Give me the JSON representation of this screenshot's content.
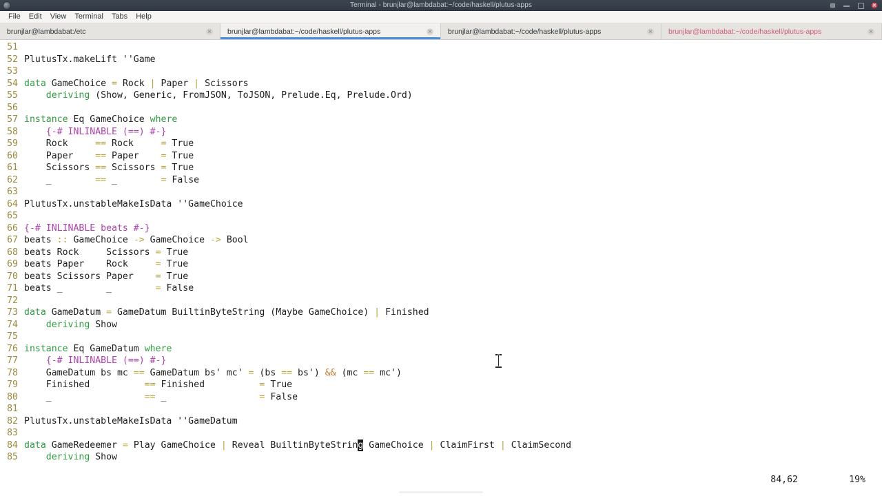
{
  "window": {
    "title": "Terminal - brunjlar@lambdabat:~/code/haskell/plutus-apps",
    "app_icon": "terminal-icon",
    "controls": {
      "shade_label": "Shade",
      "minimize_label": "Minimize",
      "maximize_label": "Maximize",
      "close_label": "Close"
    }
  },
  "menubar": {
    "items": [
      {
        "label": "File"
      },
      {
        "label": "Edit"
      },
      {
        "label": "View"
      },
      {
        "label": "Terminal"
      },
      {
        "label": "Tabs"
      },
      {
        "label": "Help"
      }
    ]
  },
  "tabs": [
    {
      "label": "brunjlar@lambdabat:/etc",
      "active": false,
      "activity": false
    },
    {
      "label": "brunjlar@lambdabat:~/code/haskell/plutus-apps",
      "active": true,
      "activity": false
    },
    {
      "label": "brunjlar@lambdabat:~/code/haskell/plutus-apps",
      "active": false,
      "activity": false
    },
    {
      "label": "brunjlar@lambdabat:~/code/haskell/plutus-apps",
      "active": false,
      "activity": true
    }
  ],
  "editor": {
    "cursor_char": "g",
    "lines": [
      {
        "n": "51",
        "segments": []
      },
      {
        "n": "52",
        "segments": [
          {
            "t": "PlutusTx.makeLift ''Game"
          }
        ]
      },
      {
        "n": "53",
        "segments": []
      },
      {
        "n": "54",
        "segments": [
          {
            "t": "data",
            "c": "kw"
          },
          {
            "t": " GameChoice "
          },
          {
            "t": "=",
            "c": "op"
          },
          {
            "t": " Rock "
          },
          {
            "t": "|",
            "c": "op"
          },
          {
            "t": " Paper "
          },
          {
            "t": "|",
            "c": "op"
          },
          {
            "t": " Scissors"
          }
        ]
      },
      {
        "n": "55",
        "segments": [
          {
            "t": "    "
          },
          {
            "t": "deriving",
            "c": "kw"
          },
          {
            "t": " (Show, Generic, FromJSON, ToJSON, Prelude.Eq, Prelude.Ord)"
          }
        ]
      },
      {
        "n": "56",
        "segments": []
      },
      {
        "n": "57",
        "segments": [
          {
            "t": "instance",
            "c": "kw"
          },
          {
            "t": " Eq GameChoice "
          },
          {
            "t": "where",
            "c": "kw"
          }
        ]
      },
      {
        "n": "58",
        "segments": [
          {
            "t": "    "
          },
          {
            "t": "{-# INLINABLE (==) #-}",
            "c": "prag"
          }
        ]
      },
      {
        "n": "59",
        "segments": [
          {
            "t": "    Rock     "
          },
          {
            "t": "==",
            "c": "op"
          },
          {
            "t": " Rock     "
          },
          {
            "t": "=",
            "c": "op"
          },
          {
            "t": " True"
          }
        ]
      },
      {
        "n": "60",
        "segments": [
          {
            "t": "    Paper    "
          },
          {
            "t": "==",
            "c": "op"
          },
          {
            "t": " Paper    "
          },
          {
            "t": "=",
            "c": "op"
          },
          {
            "t": " True"
          }
        ]
      },
      {
        "n": "61",
        "segments": [
          {
            "t": "    Scissors "
          },
          {
            "t": "==",
            "c": "op"
          },
          {
            "t": " Scissors "
          },
          {
            "t": "=",
            "c": "op"
          },
          {
            "t": " True"
          }
        ]
      },
      {
        "n": "62",
        "segments": [
          {
            "t": "    _        "
          },
          {
            "t": "==",
            "c": "op"
          },
          {
            "t": " _        "
          },
          {
            "t": "=",
            "c": "op"
          },
          {
            "t": " False"
          }
        ]
      },
      {
        "n": "63",
        "segments": []
      },
      {
        "n": "64",
        "segments": [
          {
            "t": "PlutusTx.unstableMakeIsData ''GameChoice"
          }
        ]
      },
      {
        "n": "65",
        "segments": []
      },
      {
        "n": "66",
        "segments": [
          {
            "t": "{-# INLINABLE beats #-}",
            "c": "prag"
          }
        ]
      },
      {
        "n": "67",
        "segments": [
          {
            "t": "beats "
          },
          {
            "t": "::",
            "c": "op"
          },
          {
            "t": " GameChoice "
          },
          {
            "t": "->",
            "c": "op"
          },
          {
            "t": " GameChoice "
          },
          {
            "t": "->",
            "c": "op"
          },
          {
            "t": " Bool"
          }
        ]
      },
      {
        "n": "68",
        "segments": [
          {
            "t": "beats Rock     Scissors "
          },
          {
            "t": "=",
            "c": "op"
          },
          {
            "t": " True"
          }
        ]
      },
      {
        "n": "69",
        "segments": [
          {
            "t": "beats Paper    Rock     "
          },
          {
            "t": "=",
            "c": "op"
          },
          {
            "t": " True"
          }
        ]
      },
      {
        "n": "70",
        "segments": [
          {
            "t": "beats Scissors Paper    "
          },
          {
            "t": "=",
            "c": "op"
          },
          {
            "t": " True"
          }
        ]
      },
      {
        "n": "71",
        "segments": [
          {
            "t": "beats _        _        "
          },
          {
            "t": "=",
            "c": "op"
          },
          {
            "t": " False"
          }
        ]
      },
      {
        "n": "72",
        "segments": []
      },
      {
        "n": "73",
        "segments": [
          {
            "t": "data",
            "c": "kw"
          },
          {
            "t": " GameDatum "
          },
          {
            "t": "=",
            "c": "op"
          },
          {
            "t": " GameDatum BuiltinByteString (Maybe GameChoice) "
          },
          {
            "t": "|",
            "c": "op"
          },
          {
            "t": " Finished"
          }
        ]
      },
      {
        "n": "74",
        "segments": [
          {
            "t": "    "
          },
          {
            "t": "deriving",
            "c": "kw"
          },
          {
            "t": " Show"
          }
        ]
      },
      {
        "n": "75",
        "segments": []
      },
      {
        "n": "76",
        "segments": [
          {
            "t": "instance",
            "c": "kw"
          },
          {
            "t": " Eq GameDatum "
          },
          {
            "t": "where",
            "c": "kw"
          }
        ]
      },
      {
        "n": "77",
        "segments": [
          {
            "t": "    "
          },
          {
            "t": "{-# INLINABLE (==) #-}",
            "c": "prag"
          }
        ]
      },
      {
        "n": "78",
        "segments": [
          {
            "t": "    GameDatum bs mc "
          },
          {
            "t": "==",
            "c": "op"
          },
          {
            "t": " GameDatum bs' mc' "
          },
          {
            "t": "=",
            "c": "op"
          },
          {
            "t": " (bs "
          },
          {
            "t": "==",
            "c": "op"
          },
          {
            "t": " bs') "
          },
          {
            "t": "&&",
            "c": "amp"
          },
          {
            "t": " (mc "
          },
          {
            "t": "==",
            "c": "op"
          },
          {
            "t": " mc')"
          }
        ]
      },
      {
        "n": "79",
        "segments": [
          {
            "t": "    Finished          "
          },
          {
            "t": "==",
            "c": "op"
          },
          {
            "t": " Finished          "
          },
          {
            "t": "=",
            "c": "op"
          },
          {
            "t": " True"
          }
        ]
      },
      {
        "n": "80",
        "segments": [
          {
            "t": "    _                 "
          },
          {
            "t": "==",
            "c": "op"
          },
          {
            "t": " _                 "
          },
          {
            "t": "=",
            "c": "op"
          },
          {
            "t": " False"
          }
        ]
      },
      {
        "n": "81",
        "segments": []
      },
      {
        "n": "82",
        "segments": [
          {
            "t": "PlutusTx.unstableMakeIsData ''GameDatum"
          }
        ]
      },
      {
        "n": "83",
        "segments": []
      },
      {
        "n": "84",
        "segments": [
          {
            "t": "data",
            "c": "kw"
          },
          {
            "t": " GameRedeemer "
          },
          {
            "t": "=",
            "c": "op"
          },
          {
            "t": " Play GameChoice "
          },
          {
            "t": "|",
            "c": "op"
          },
          {
            "t": " Reveal BuiltinByteStrin"
          },
          {
            "t": "g",
            "c": "cursor"
          },
          {
            "t": " GameChoice "
          },
          {
            "t": "|",
            "c": "op"
          },
          {
            "t": " ClaimFirst "
          },
          {
            "t": "|",
            "c": "op"
          },
          {
            "t": " ClaimSecond"
          }
        ]
      },
      {
        "n": "85",
        "segments": [
          {
            "t": "    "
          },
          {
            "t": "deriving",
            "c": "kw"
          },
          {
            "t": " Show"
          }
        ]
      }
    ]
  },
  "statusline": {
    "position": "84,62",
    "percent": "19%"
  }
}
